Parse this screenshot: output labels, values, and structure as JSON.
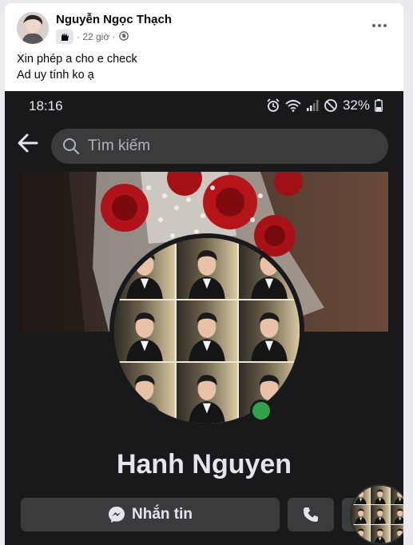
{
  "post": {
    "author": "Nguyễn Ngọc Thạch",
    "time": "· 22 giờ ·",
    "text_lines": [
      "Xin phép a cho e check",
      "Ad uy tính ko ạ"
    ]
  },
  "phone": {
    "time": "18:16",
    "battery": "32%",
    "search_placeholder": "Tìm kiếm",
    "profile_name": "Hanh Nguyen",
    "message_button": "Nhắn tin"
  },
  "colors": {
    "dark_bg": "#18191a",
    "button_bg": "#3a3b3c",
    "online": "#31a24c",
    "text_light": "#e4e6eb"
  },
  "icons": [
    "more-options-icon",
    "globe-icon",
    "group-badge-icon",
    "back-arrow-icon",
    "search-icon",
    "messenger-icon",
    "phone-icon",
    "alarm-icon",
    "wifi-icon",
    "signal-icon",
    "dnd-icon",
    "battery-icon"
  ]
}
